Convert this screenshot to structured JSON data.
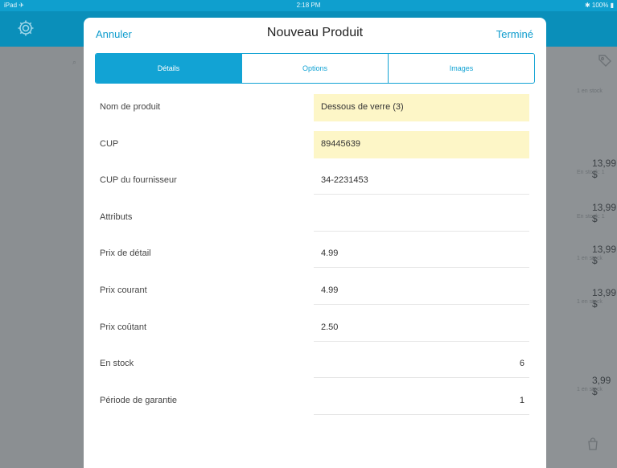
{
  "status_bar": {
    "carrier": "iPad ✈",
    "time": "2:18 PM",
    "battery": "✱ 100% ▮"
  },
  "background": {
    "right_items": [
      {
        "price": "",
        "sub": "1 en stock"
      },
      {
        "price": "13,99 $",
        "sub": "En stock: 1"
      },
      {
        "price": "13,99 $",
        "sub": "En stock: 1"
      },
      {
        "price": "13,99 $",
        "sub": "1 en stock"
      },
      {
        "price": "13,99 $",
        "sub": "1 en stock"
      },
      {
        "price": "3,99 $",
        "sub": "1 en stock"
      }
    ]
  },
  "modal": {
    "cancel_label": "Annuler",
    "title": "Nouveau Produit",
    "done_label": "Terminé",
    "tabs": [
      {
        "label": "Détails",
        "active": true
      },
      {
        "label": "Options",
        "active": false
      },
      {
        "label": "Images",
        "active": false
      }
    ],
    "fields": [
      {
        "label": "Nom de produit",
        "value": "Dessous de verre (3)",
        "highlighted": true,
        "align": "left"
      },
      {
        "label": "CUP",
        "value": "89445639",
        "highlighted": true,
        "align": "left"
      },
      {
        "label": "CUP du fournisseur",
        "value": "34-2231453",
        "highlighted": false,
        "align": "left"
      },
      {
        "label": "Attributs",
        "value": "",
        "highlighted": false,
        "align": "left"
      },
      {
        "label": "Prix de détail",
        "value": "4.99",
        "highlighted": false,
        "align": "left"
      },
      {
        "label": "Prix courant",
        "value": "4.99",
        "highlighted": false,
        "align": "left"
      },
      {
        "label": "Prix coûtant",
        "value": "2.50",
        "highlighted": false,
        "align": "left"
      },
      {
        "label": "En stock",
        "value": "6",
        "highlighted": false,
        "align": "right"
      },
      {
        "label": "Période de garantie",
        "value": "1",
        "highlighted": false,
        "align": "right"
      }
    ]
  },
  "colors": {
    "accent": "#12a3d4",
    "highlight": "#fdf6c7",
    "status_bar": "#0f9fce"
  }
}
